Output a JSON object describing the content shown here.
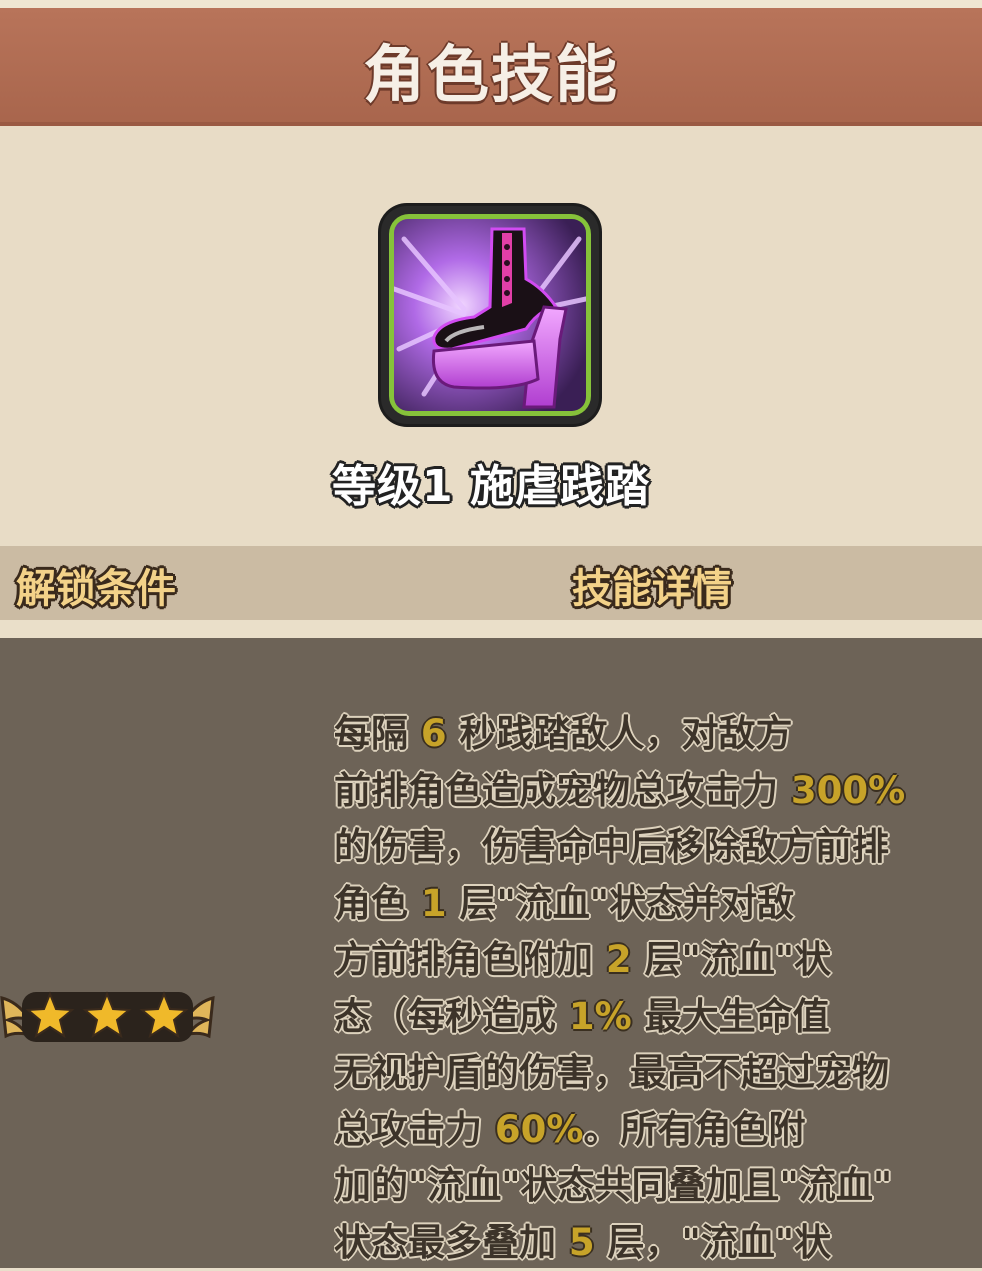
{
  "header": {
    "title": "角色技能"
  },
  "skill": {
    "icon": "high-heel-boot-icon",
    "name": "等级1 施虐践踏"
  },
  "sections": {
    "unlock_label": "解锁条件",
    "detail_label": "技能详情"
  },
  "unlock": {
    "stars": 3,
    "icon": "winged-stars-icon"
  },
  "description": {
    "highlight_color": "#c7a329",
    "lines": [
      {
        "a": "每隔 ",
        "b": "6",
        "c": " 秒践踏敌人，对敌方"
      },
      {
        "a": "前排角色造成宠物总攻击力 ",
        "b": "300%",
        "c": ""
      },
      {
        "a": "的伤害，伤害命中后移除敌方前排",
        "b": "",
        "c": ""
      },
      {
        "a": "角色 ",
        "b": "1",
        "c": " 层\"流血\"状态并对敌"
      },
      {
        "a": "方前排角色附加 ",
        "b": "2",
        "c": " 层\"流血\"状"
      },
      {
        "a": "态（每秒造成 ",
        "b": "1%",
        "c": " 最大生命值"
      },
      {
        "a": "无视护盾的伤害，最高不超过宠物",
        "b": "",
        "c": ""
      },
      {
        "a": "总攻击力 ",
        "b": "60%",
        "c": "。所有角色附"
      },
      {
        "a": "加的\"流血\"状态共同叠加且\"流血\"",
        "b": "",
        "c": ""
      },
      {
        "a": "状态最多叠加 ",
        "b": "5",
        "c": " 层，\"流血\"状"
      }
    ]
  }
}
